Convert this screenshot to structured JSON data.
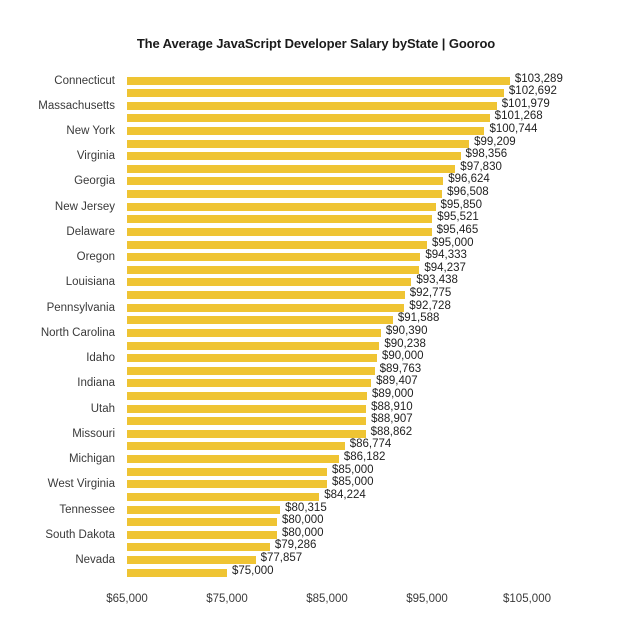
{
  "chart_data": {
    "type": "bar",
    "orientation": "horizontal",
    "title": "The Average JavaScript Developer Salary byState | Gooroo",
    "xlabel": "",
    "ylabel": "",
    "xlim": [
      65000,
      105000
    ],
    "xticks": [
      65000,
      75000,
      85000,
      95000,
      105000
    ],
    "xtick_labels": [
      "$65,000",
      "$75,000",
      "$85,000",
      "$95,000",
      "$105,000"
    ],
    "grid": false,
    "legend": false,
    "bar_color": "#EFC433",
    "value_label_color": "#1f1f1f",
    "category_label_color": "#3a3a3a",
    "categories": [
      "Connecticut",
      "",
      "Massachusetts",
      "",
      "New York",
      "",
      "Virginia",
      "",
      "Georgia",
      "",
      "New Jersey",
      "",
      "Delaware",
      "",
      "Oregon",
      "",
      "Louisiana",
      "",
      "Pennsylvania",
      "",
      "North Carolina",
      "",
      "Idaho",
      "",
      "Indiana",
      "",
      "Utah",
      "",
      "Missouri",
      "",
      "Michigan",
      "",
      "West Virginia",
      "",
      "Tennessee",
      "",
      "South Dakota",
      "",
      "Nevada",
      ""
    ],
    "values": [
      103289,
      102692,
      101979,
      101268,
      100744,
      99209,
      98356,
      97830,
      96624,
      96508,
      95850,
      95521,
      95465,
      95000,
      94333,
      94237,
      93438,
      92775,
      92728,
      91588,
      90390,
      90238,
      90000,
      89763,
      89407,
      89000,
      88910,
      88907,
      88862,
      86774,
      86182,
      85000,
      85000,
      84224,
      80315,
      80000,
      80000,
      79286,
      77857,
      75000
    ],
    "value_labels": [
      "$103,289",
      "$102,692",
      "$101,979",
      "$101,268",
      "$100,744",
      "$99,209",
      "$98,356",
      "$97,830",
      "$96,624",
      "$96,508",
      "$95,850",
      "$95,521",
      "$95,465",
      "$95,000",
      "$94,333",
      "$94,237",
      "$93,438",
      "$92,775",
      "$92,728",
      "$91,588",
      "$90,390",
      "$90,238",
      "$90,000",
      "$89,763",
      "$89,407",
      "$89,000",
      "$88,910",
      "$88,907",
      "$88,862",
      "$86,774",
      "$86,182",
      "$85,000",
      "$85,000",
      "$84,224",
      "$80,315",
      "$80,000",
      "$80,000",
      "$79,286",
      "$77,857",
      "$75,000"
    ]
  }
}
